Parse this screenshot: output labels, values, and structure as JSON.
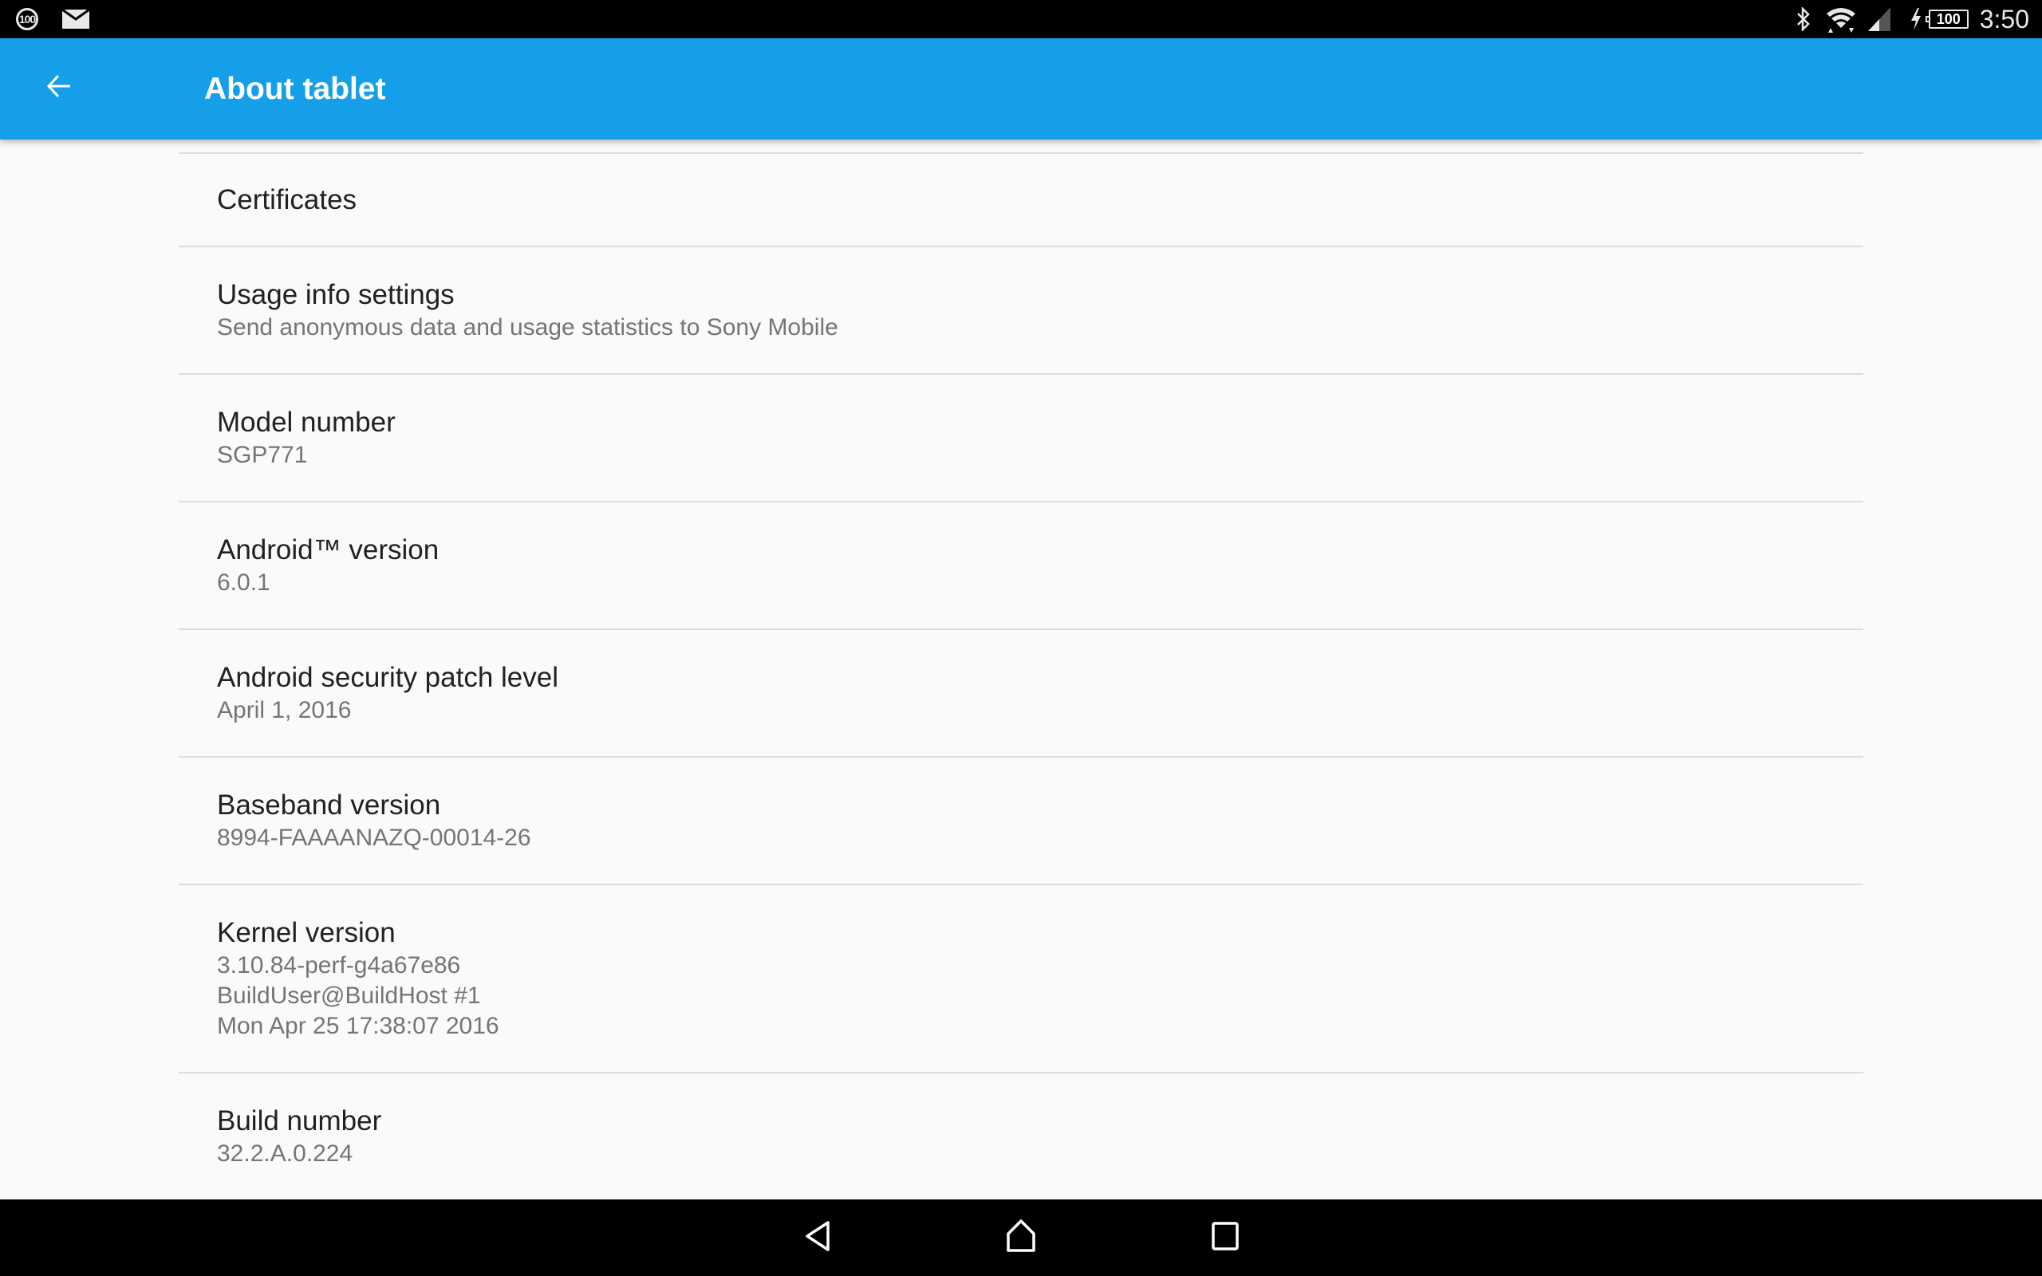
{
  "status_bar": {
    "notification_badge": "100",
    "left_icons": [
      "notification-count-icon",
      "email-icon"
    ],
    "right_icons": [
      "bluetooth-icon",
      "wifi-icon",
      "cell-signal-icon",
      "charging-icon",
      "battery-icon"
    ],
    "battery_level": "100",
    "time": "3:50"
  },
  "app_bar": {
    "back_icon": "arrow-back-icon",
    "title": "About tablet",
    "color": "#169FE9"
  },
  "preferences": [
    {
      "title": "Certificates"
    },
    {
      "title": "Usage info settings",
      "summary": "Send anonymous data and usage statistics to Sony Mobile"
    },
    {
      "title": "Model number",
      "summary": "SGP771"
    },
    {
      "title": "Android™ version",
      "summary": "6.0.1"
    },
    {
      "title": "Android security patch level",
      "summary": "April 1, 2016"
    },
    {
      "title": "Baseband version",
      "summary": "8994-FAAAANAZQ-00014-26"
    },
    {
      "title": "Kernel version",
      "summary_lines": [
        "3.10.84-perf-g4a67e86",
        "BuildUser@BuildHost #1",
        "Mon Apr 25 17:38:07 2016"
      ]
    },
    {
      "title": "Build number",
      "summary": "32.2.A.0.224"
    }
  ],
  "nav_bar": {
    "buttons": [
      "back-triangle-icon",
      "home-icon",
      "recents-square-icon"
    ]
  }
}
